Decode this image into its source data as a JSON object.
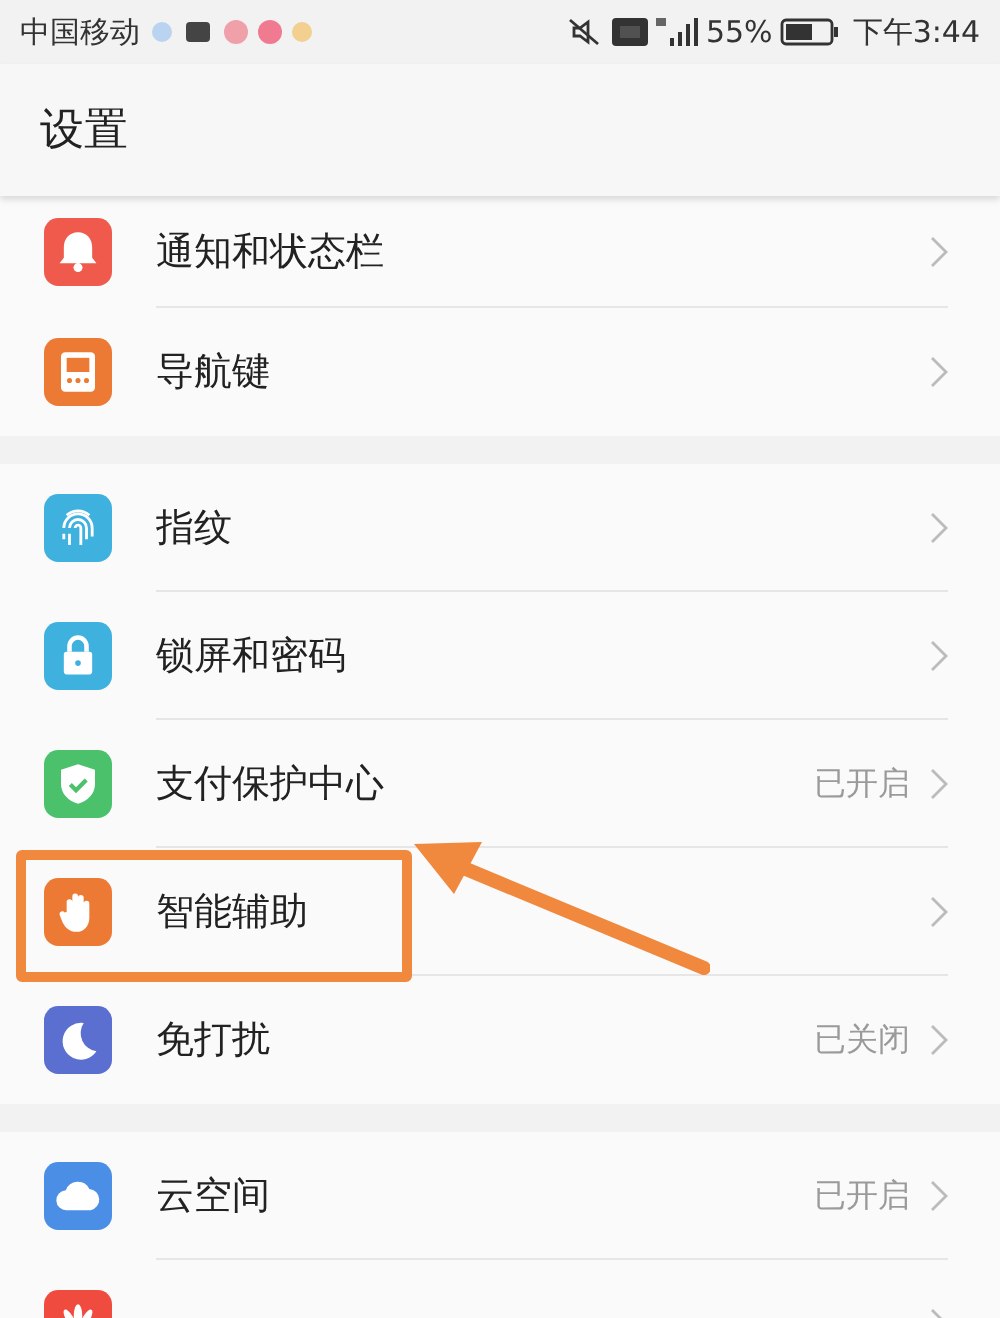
{
  "status_bar": {
    "carrier": "中国移动",
    "battery": "55%",
    "time": "下午3:44"
  },
  "title": "设置",
  "sections": [
    {
      "items": [
        {
          "label": "通知和状态栏",
          "kind": "bell",
          "color": "#ef5a4c",
          "highlighted": false
        },
        {
          "label": "导航键",
          "kind": "keys",
          "color": "#ec7a35",
          "highlighted": false
        }
      ]
    },
    {
      "items": [
        {
          "label": "指纹",
          "kind": "fingerprint",
          "color": "#3fb1de",
          "highlighted": false
        },
        {
          "label": "锁屏和密码",
          "kind": "lock",
          "color": "#3fb1de",
          "highlighted": false
        },
        {
          "label": "支付保护中心",
          "kind": "shield",
          "color": "#4cc16c",
          "value": "已开启",
          "highlighted": false
        },
        {
          "label": "智能辅助",
          "kind": "hand",
          "color": "#ec7a35",
          "highlighted": true
        },
        {
          "label": "免打扰",
          "kind": "moon",
          "color": "#5b6fd0",
          "value": "已关闭",
          "highlighted": false
        }
      ]
    },
    {
      "items": [
        {
          "label": "云空间",
          "kind": "cloud",
          "color": "#4a8ee6",
          "value": "已开启",
          "highlighted": false
        },
        {
          "kind": "flower",
          "color": "#ef4b3f",
          "highlighted": false
        }
      ]
    }
  ]
}
